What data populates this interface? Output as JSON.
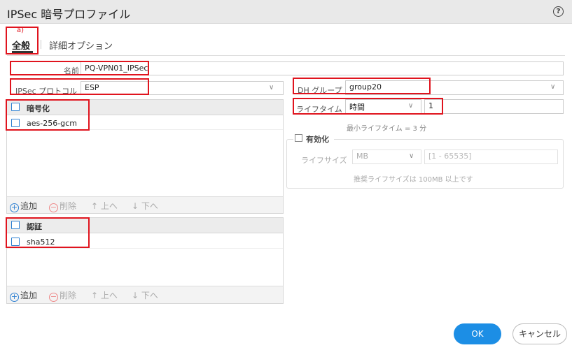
{
  "dialog": {
    "title": "IPSec 暗号プロファイル",
    "help_icon": "question-circle-icon"
  },
  "annotation": {
    "label": "a)"
  },
  "tabs": [
    {
      "label": "全般"
    },
    {
      "label": "詳細オプション"
    }
  ],
  "name": {
    "label": "名前",
    "value": "PQ-VPN01_IPSec"
  },
  "ipsec_protocol": {
    "label": "IPSec プロトコル",
    "value": "ESP"
  },
  "encryption": {
    "header": "暗号化",
    "rows": [
      "aes-256-gcm"
    ]
  },
  "auth": {
    "header": "認証",
    "rows": [
      "sha512"
    ]
  },
  "toolbar": {
    "add": "追加",
    "delete": "削除",
    "up": "上へ",
    "down": "下へ"
  },
  "dh_group": {
    "label": "DH グループ",
    "value": "group20"
  },
  "lifetime": {
    "label": "ライフタイム",
    "unit": "時間",
    "value": "1",
    "hint": "最小ライフタイム = 3 分"
  },
  "lifesize": {
    "enable_label": "有効化",
    "label": "ライフサイズ",
    "unit": "MB",
    "placeholder": "[1 - 65535]",
    "hint": "推奨ライフサイズは 100MB 以上です"
  },
  "buttons": {
    "ok": "OK",
    "cancel": "キャンセル"
  },
  "colors": {
    "highlight": "#e0141e",
    "primary": "#1c8ee5",
    "checkbox": "#2c7fd1"
  }
}
